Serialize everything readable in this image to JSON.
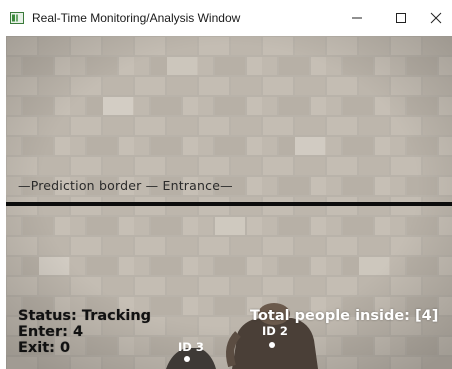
{
  "window": {
    "title": "Real-Time Monitoring/Analysis Window",
    "controls": {
      "minimize_icon": "minimize-icon",
      "maximize_icon": "maximize-icon",
      "close_icon": "close-icon"
    }
  },
  "overlay": {
    "border_label": "—Prediction border — Entrance—",
    "status": "Status: Tracking",
    "enter": "Enter: 4",
    "exit": "Exit: 0",
    "total": "Total people inside: [4]",
    "tracked_ids": [
      "ID 2",
      "ID 3"
    ]
  },
  "colors": {
    "border_line": "#0c0c0c",
    "hud_dark_text": "#111111",
    "hud_light_text": "#ffffff",
    "pavement": "#b9b3aa"
  }
}
